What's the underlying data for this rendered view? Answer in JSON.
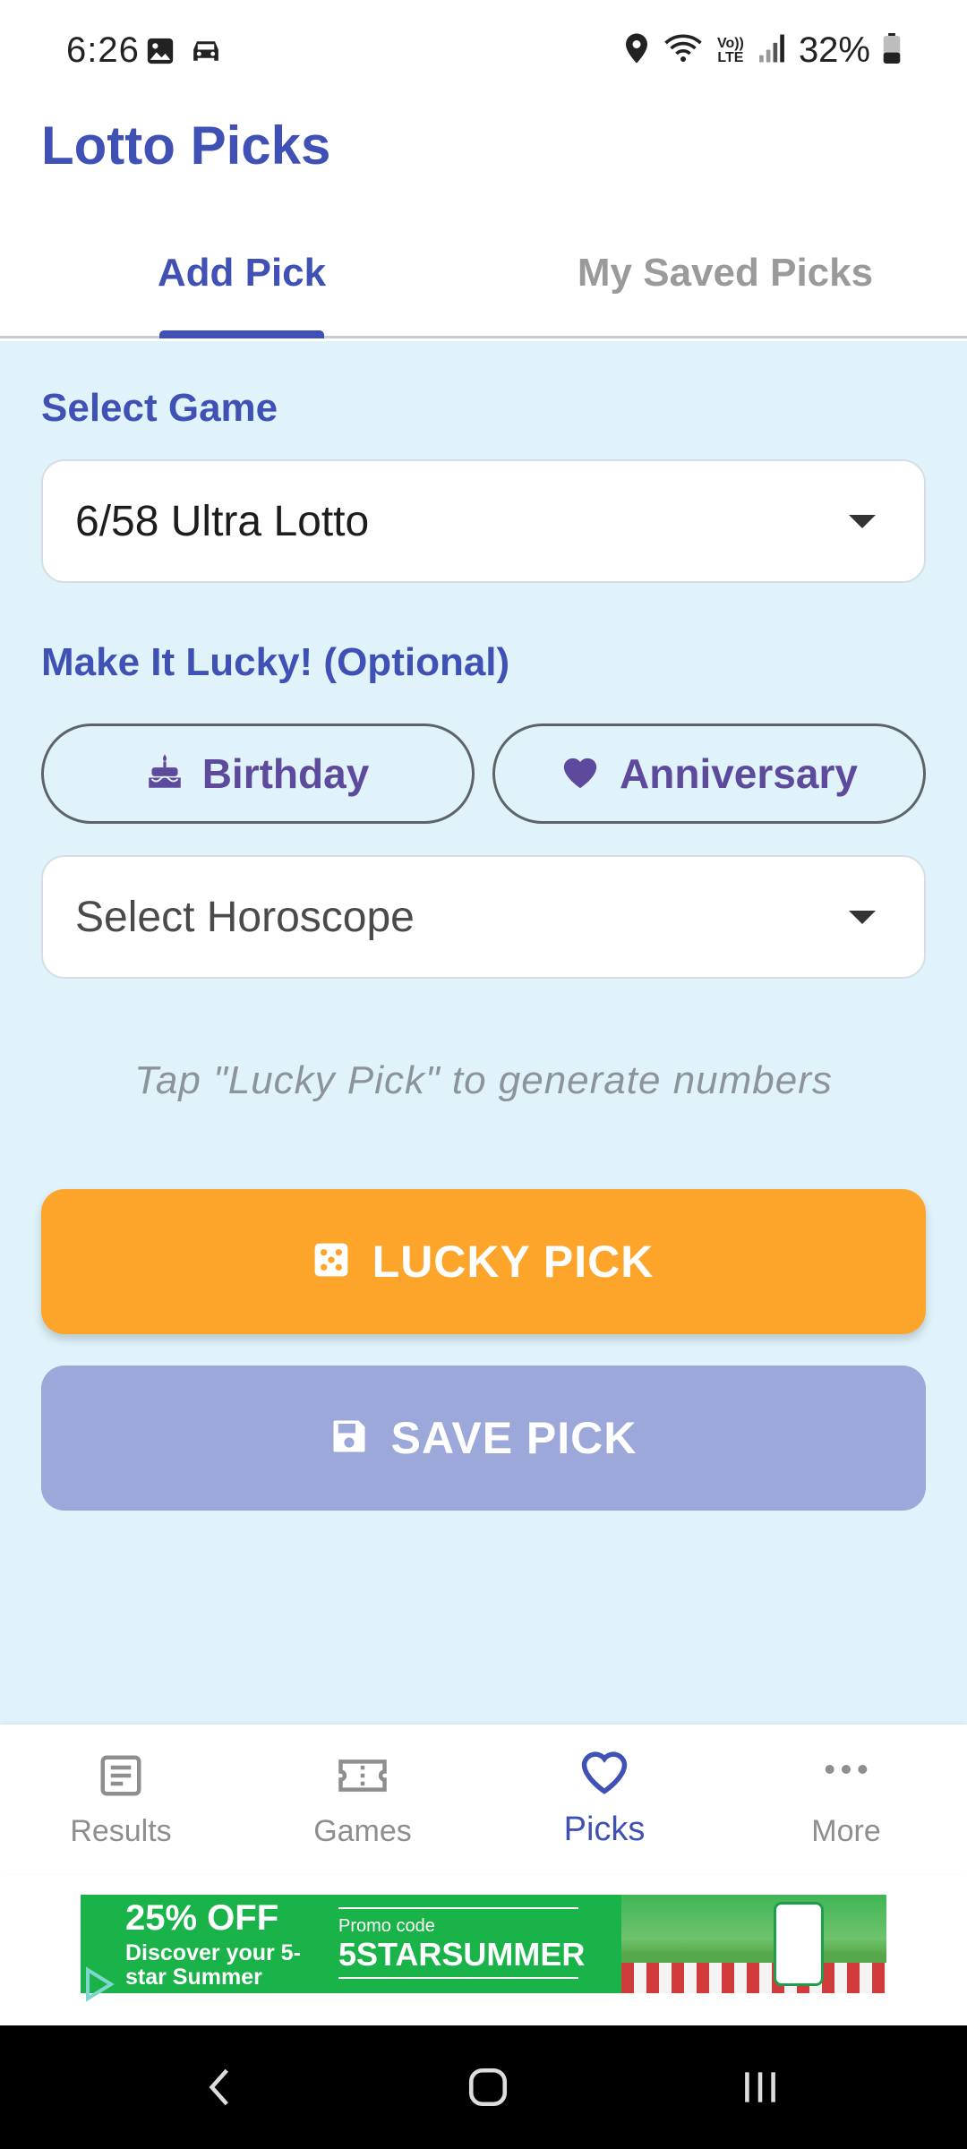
{
  "status_bar": {
    "time": "6:26",
    "battery_text": "32%",
    "left_icons": [
      "gallery-icon",
      "car-icon"
    ],
    "right_icons": [
      "location-icon",
      "wifi-icon",
      "volte-icon",
      "signal-icon",
      "battery-icon"
    ],
    "volte_text": "Vo)) LTE"
  },
  "header": {
    "title": "Lotto Picks"
  },
  "tabs": [
    {
      "label": "Add Pick",
      "active": true
    },
    {
      "label": "My Saved Picks",
      "active": false
    }
  ],
  "form": {
    "select_game_label": "Select Game",
    "game_value": "6/58 Ultra Lotto",
    "lucky_label": "Make It Lucky! (Optional)",
    "chips": [
      {
        "label": "Birthday",
        "icon": "cake-icon"
      },
      {
        "label": "Anniversary",
        "icon": "heart-icon"
      }
    ],
    "horoscope_placeholder": "Select Horoscope",
    "hint": "Tap \"Lucky Pick\" to generate numbers",
    "lucky_button": "LUCKY PICK",
    "save_button": "SAVE PICK"
  },
  "bottom_nav": [
    {
      "label": "Results",
      "icon": "article-icon",
      "active": false
    },
    {
      "label": "Games",
      "icon": "ticket-icon",
      "active": false
    },
    {
      "label": "Picks",
      "icon": "heart-outline-icon",
      "active": true
    },
    {
      "label": "More",
      "icon": "more-horizontal-icon",
      "active": false
    }
  ],
  "ad": {
    "headline": "25% OFF",
    "sub": "Discover your 5-star Summer",
    "promo_label": "Promo code",
    "promo_code": "5STARSUMMER"
  },
  "colors": {
    "primary": "#3f51b5",
    "content_bg": "#e0f3fb",
    "lucky_button": "#fca52a",
    "save_button": "#9ca8da",
    "chip_text": "#5e4a9c",
    "ad_green": "#19b34a"
  }
}
